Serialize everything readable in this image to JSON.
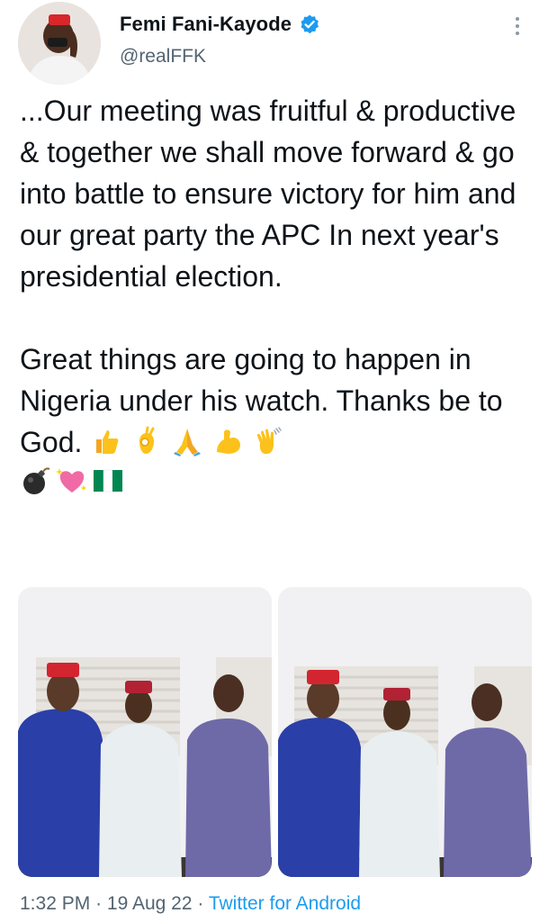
{
  "author": {
    "display_name": "Femi Fani-Kayode",
    "handle": "@realFFK",
    "verified_icon": "verified-badge-icon"
  },
  "tweet": {
    "paragraphs": [
      "...Our meeting was fruitful & productive & together we shall move forward & go into battle to ensure victory for him and our great party the APC In next year's presidential election.",
      "Great things are going to happen in Nigeria under his watch. Thanks be to God."
    ],
    "emojis": [
      "thumbs-up-icon",
      "ok-hand-icon",
      "folded-hands-icon",
      "flexed-biceps-icon",
      "waving-hand-icon",
      "bomb-icon",
      "sparkling-heart-icon",
      "nigeria-flag-icon"
    ]
  },
  "media": {
    "photos": [
      "photo-1",
      "photo-2"
    ]
  },
  "meta": {
    "time": "1:32 PM",
    "date": "19 Aug 22",
    "separator": "·",
    "source": "Twitter for Android"
  },
  "colors": {
    "text": "#0f1419",
    "muted": "#536471",
    "link": "#1d9bf0"
  }
}
